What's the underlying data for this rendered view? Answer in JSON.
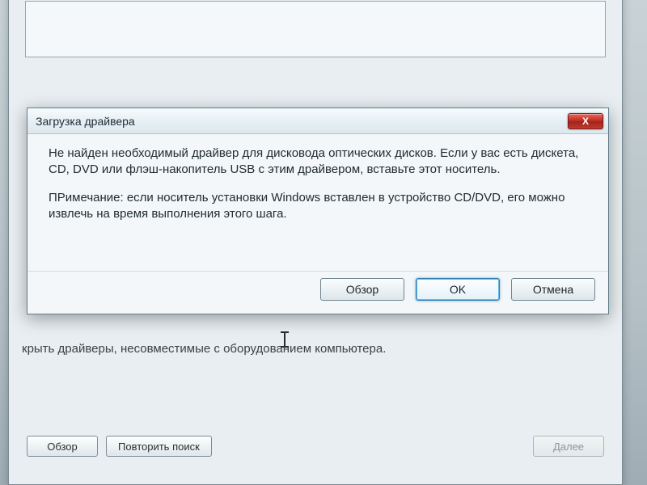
{
  "parent": {
    "hidden_text": "крыть драйверы, несовместимые с оборудованием компьютера.",
    "buttons": {
      "browse": "Обзор",
      "rescan": "Повторить поиск",
      "next": "Далее"
    }
  },
  "dialog": {
    "title": "Загрузка драйвера",
    "paragraph1": "Не найден необходимый драйвер для дисковода оптических дисков. Если у вас есть дискета, CD, DVD или флэш-накопитель USB с этим драйвером, вставьте этот носитель.",
    "paragraph2": "ПРимечание: если носитель установки Windows вставлен в устройство CD/DVD, его можно извлечь на время выполнения этого шага.",
    "buttons": {
      "browse": "Обзор",
      "ok": "OK",
      "cancel": "Отмена"
    },
    "close_glyph": "X"
  }
}
